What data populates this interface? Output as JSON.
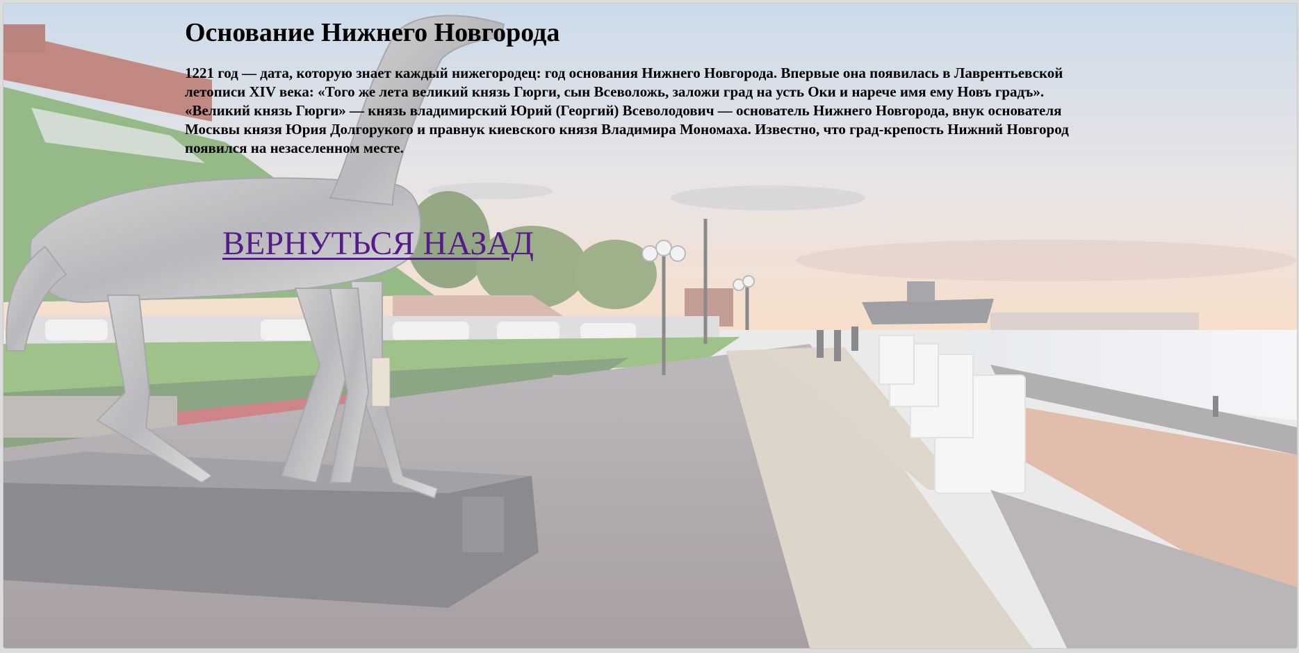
{
  "page": {
    "title": "Основание Нижнего Новгорода",
    "paragraph": "1221 год — дата, которую знает каждый нижегородец: год основания Нижнего Новгорода. Впервые она появилась в Лаврентьевской летописи XIV века: «Того же лета великий князь Гюрги, сын Всеволожь, заложи град на усть Оки и нарече имя ему Новъ градъ». «Великий князь Гюрги» — князь владимирский Юрий (Георгий) Всеволодович — основатель Нижнего Новгорода, внук основателя Москвы князя Юрия Долгорукого и правнук киевского князя Владимира Мономаха. Известно, что град-крепость Нижний Новгород появился на незаселенном месте.",
    "back_link_label": "ВЕРНУТЬСЯ НАЗАД"
  },
  "colors": {
    "link_visited": "#551a8b",
    "text": "#000000"
  }
}
